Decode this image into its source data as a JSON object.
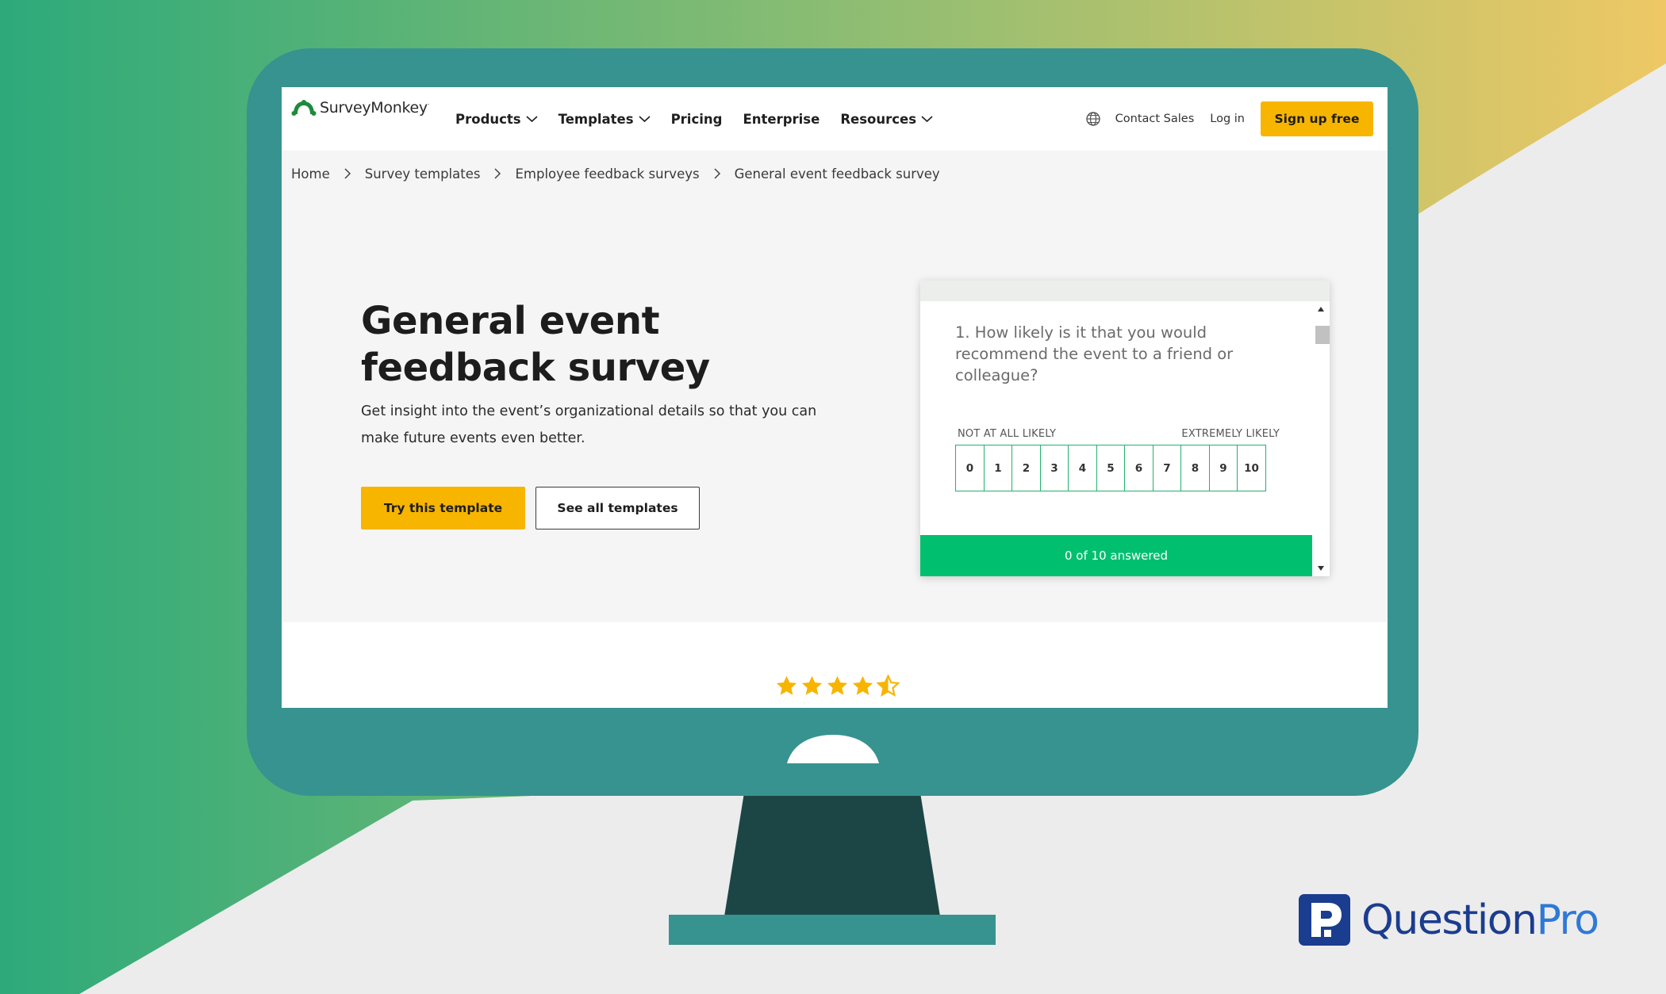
{
  "colors": {
    "monitor": "#37938f",
    "monitor_stand": "#1c4645",
    "brand_green": "#00bf6f",
    "cta_yellow": "#f7b500",
    "questionpro_dark": "#1b3d8f",
    "questionpro_blue": "#2f79d6"
  },
  "nav": {
    "brand": "SurveyMonkey",
    "brand_mark": "·",
    "items": [
      {
        "label": "Products",
        "icon": "chevron-down-icon"
      },
      {
        "label": "Templates",
        "icon": "chevron-down-icon"
      },
      {
        "label": "Pricing"
      },
      {
        "label": "Enterprise"
      },
      {
        "label": "Resources",
        "icon": "chevron-down-icon"
      }
    ],
    "contact_sales": "Contact Sales",
    "login": "Log in",
    "signup": "Sign up free"
  },
  "breadcrumb": [
    "Home",
    "Survey templates",
    "Employee feedback surveys",
    "General event feedback survey"
  ],
  "hero": {
    "title": "General event feedback survey",
    "description": "Get insight into the event’s organizational details so that you can make future events even better.",
    "try_button": "Try this template",
    "all_button": "See all templates"
  },
  "survey_preview": {
    "question": "1. How likely is it that you would recommend the event to a friend or colleague?",
    "low_label": "NOT AT ALL LIKELY",
    "high_label": "EXTREMELY LIKELY",
    "scale": [
      "0",
      "1",
      "2",
      "3",
      "4",
      "5",
      "6",
      "7",
      "8",
      "9",
      "10"
    ],
    "progress": "0 of 10 answered"
  },
  "rating": {
    "value": 4.5,
    "max": 5
  },
  "footer_brand": {
    "part1": "Question",
    "part2": "Pro"
  }
}
